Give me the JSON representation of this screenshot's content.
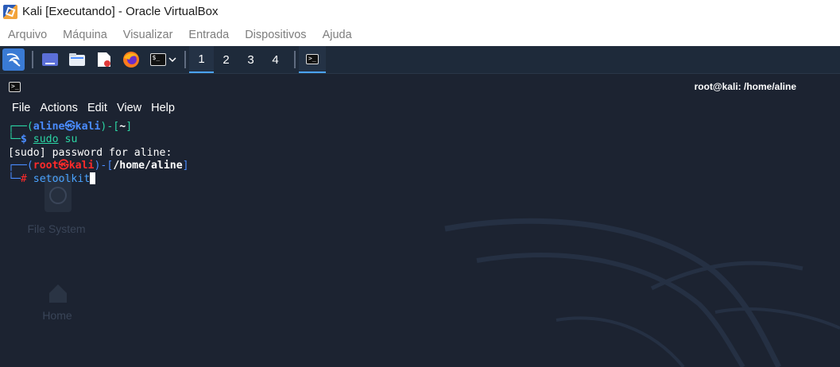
{
  "window": {
    "title": "Kali [Executando] - Oracle VirtualBox"
  },
  "host_menu": [
    "Arquivo",
    "Máquina",
    "Visualizar",
    "Entrada",
    "Dispositivos",
    "Ajuda"
  ],
  "panel": {
    "workspaces": [
      "1",
      "2",
      "3",
      "4"
    ],
    "active_workspace": "1",
    "launchers": [
      "kali-menu-icon",
      "show-desktop-icon",
      "file-manager-icon",
      "text-editor-icon",
      "firefox-icon",
      "terminal-icon"
    ]
  },
  "desktop": {
    "icons": [
      "File System",
      "Home"
    ]
  },
  "terminal": {
    "title": "root@kali: /home/aline",
    "menu": [
      "File",
      "Actions",
      "Edit",
      "View",
      "Help"
    ],
    "lines": {
      "l1_user": "aline",
      "l1_sym": "㉿",
      "l1_host": "kali",
      "l1_dir": "~",
      "l2_cmd1": "sudo",
      "l2_cmd2": "su",
      "l3": "[sudo] password for aline:",
      "l4_user": "root",
      "l4_sym": "㉿",
      "l4_host": "kali",
      "l4_dir": "/home/aline",
      "l5_cmd": "setoolkit"
    }
  },
  "colors": {
    "terminal_bg": "#1c2331",
    "prompt_green": "#2bd5a4",
    "prompt_blue": "#4a8cff",
    "root_red": "#ff2a2a",
    "panel_bg": "#1e2a3a",
    "active_accent": "#4aa3ff"
  }
}
